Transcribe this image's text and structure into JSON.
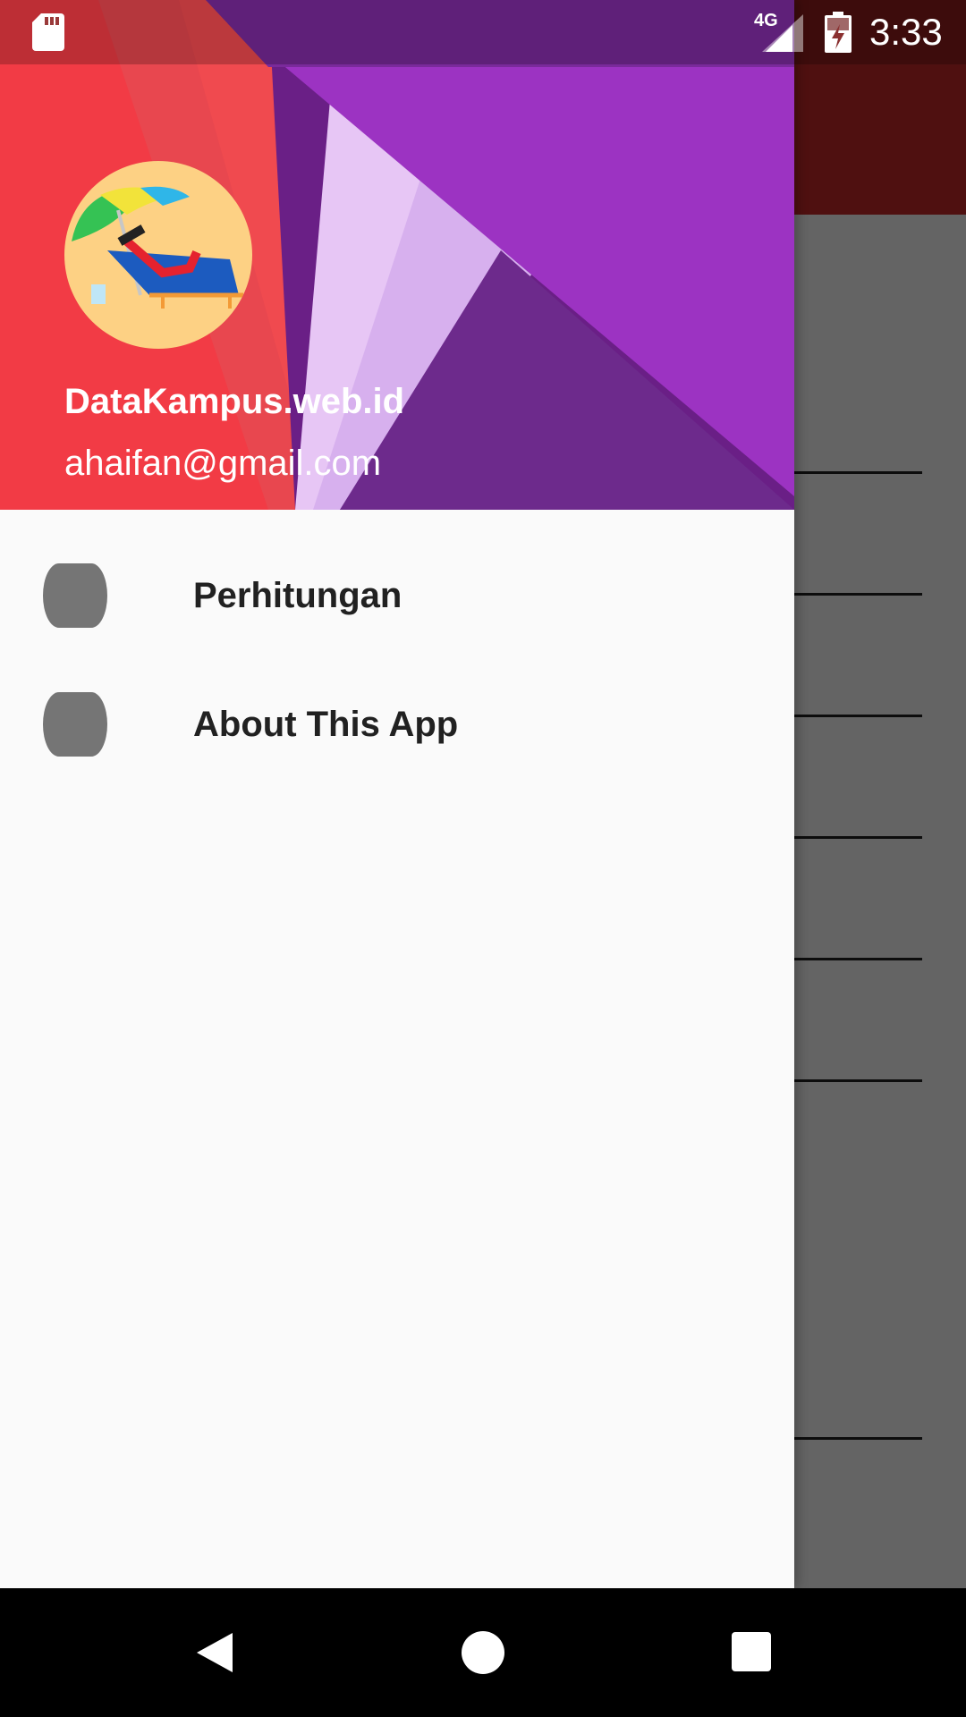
{
  "status_bar": {
    "time": "3:33",
    "network_label": "4G",
    "icons": [
      "sd-card-icon",
      "signal-icon",
      "battery-charging-icon"
    ]
  },
  "drawer": {
    "header": {
      "name": "DataKampus.web.id",
      "email": "ahaifan@gmail.com",
      "avatar_icon": "beach-chair-umbrella-icon"
    },
    "items": [
      {
        "label": "Perhitungan",
        "icon": "menu-placeholder-icon"
      },
      {
        "label": "About This App",
        "icon": "menu-placeholder-icon"
      }
    ]
  },
  "colors": {
    "toolbar": "#c62828",
    "header_red": "#f2424a",
    "header_purple": "#9c33c2",
    "drawer_bg": "#fafafa"
  },
  "nav_bar": {
    "icons": [
      "back-icon",
      "home-icon",
      "recent-apps-icon"
    ]
  }
}
